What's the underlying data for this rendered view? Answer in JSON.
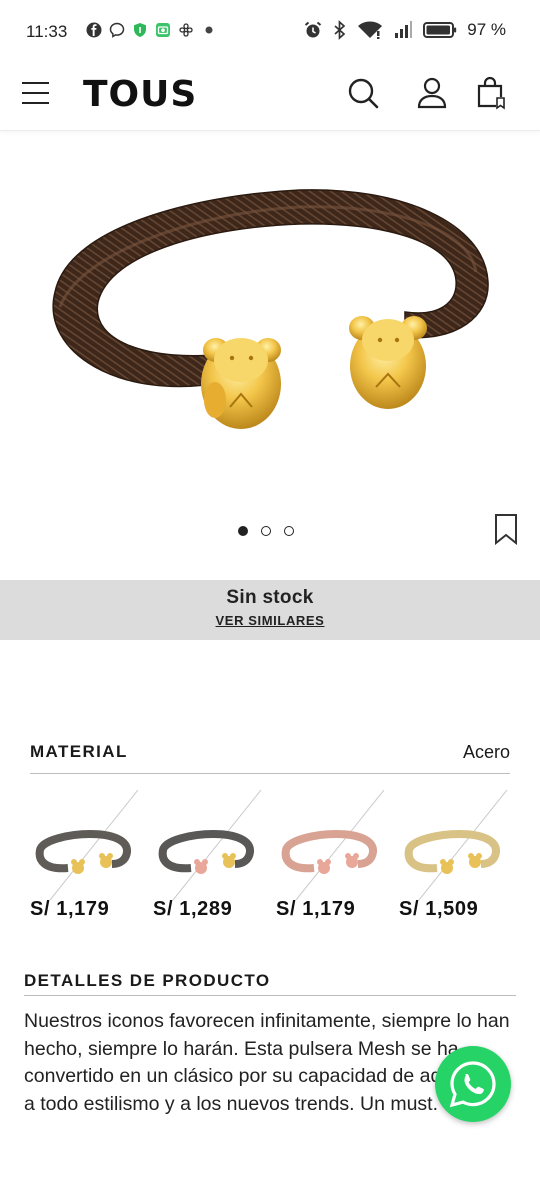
{
  "status_bar": {
    "time": "11:33",
    "battery_text": "97 %",
    "left_icons": [
      "facebook-icon",
      "chat-icon",
      "shield-icon",
      "camera-icon",
      "app-icon",
      "dot-icon"
    ],
    "right_icons": [
      "alarm-icon",
      "bluetooth-icon",
      "wifi-icon",
      "signal-icon",
      "battery-icon"
    ]
  },
  "header": {
    "logo": "TOUS",
    "icons": [
      "menu-icon",
      "search-icon",
      "user-icon",
      "bag-icon"
    ]
  },
  "gallery": {
    "dots_count": 3,
    "active_index": 0
  },
  "stock": {
    "status": "Sin stock",
    "link": "VER SIMILARES"
  },
  "material": {
    "label": "MATERIAL",
    "value": "Acero",
    "variants": [
      {
        "price": "S/ 1,179",
        "band_color": "#5f5b57",
        "bear_color": "#e8c258"
      },
      {
        "price": "S/ 1,289",
        "band_color": "#5a5857",
        "bear_color": "#e9a79a"
      },
      {
        "price": "S/ 1,179",
        "band_color": "#d9a394",
        "bear_color": "#e9a79a"
      },
      {
        "price": "S/ 1,509",
        "band_color": "#d8c285",
        "bear_color": "#e8c258"
      }
    ]
  },
  "details": {
    "label": "DETALLES DE PRODUCTO",
    "text": "Nuestros iconos favorecen infinitamente, siempre lo han hecho, siempre lo harán. Esta pulsera Mesh se ha convertido en un clásico por su capacidad de adaptarse a todo estilismo y a los nuevos trends. Un must."
  },
  "colors": {
    "accent": "#25d366",
    "stock_band": "#dcdcdc",
    "text": "#1a1a1a"
  }
}
